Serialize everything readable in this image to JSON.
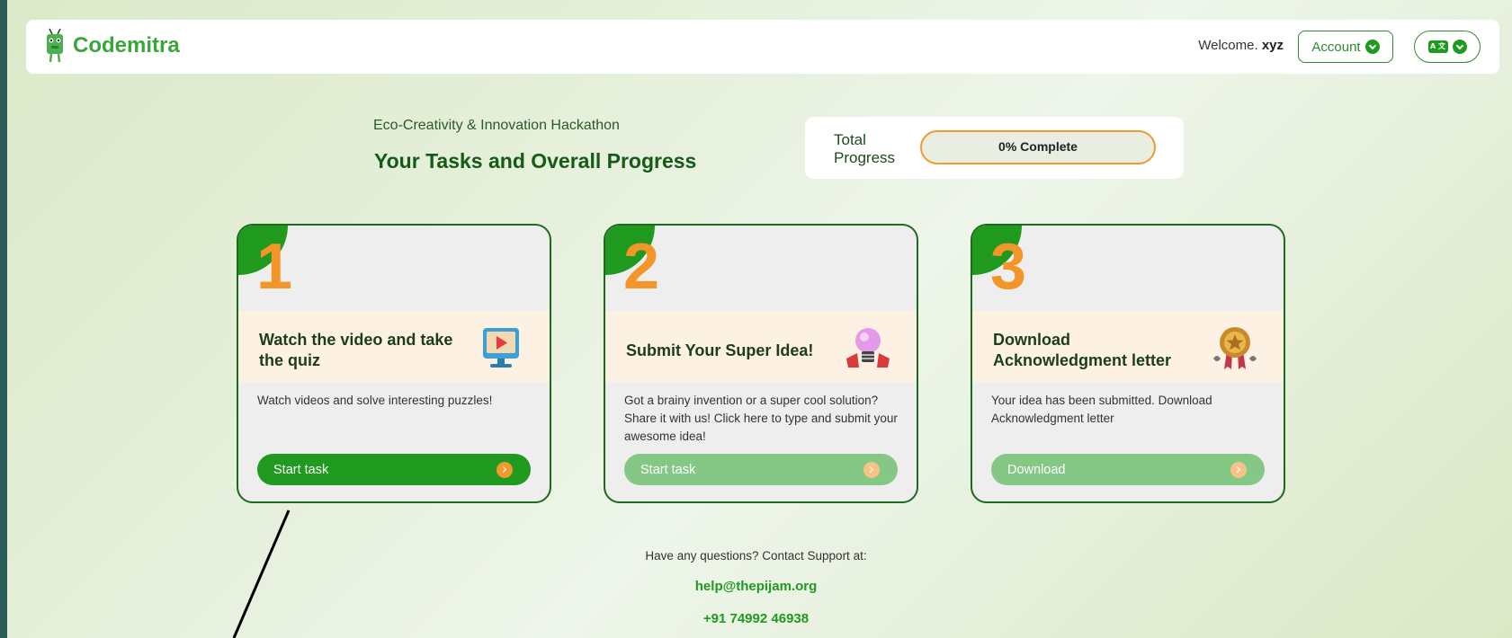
{
  "nav": {
    "brand": "Codemitra",
    "welcome_prefix": "Welcome.",
    "username": "xyz",
    "account_label": "Account",
    "lang_label": "A 文"
  },
  "header": {
    "event_name": "Eco-Creativity & Innovation Hackathon",
    "title": "Your Tasks and Overall Progress"
  },
  "progress": {
    "label_line1": "Total",
    "label_line2": "Progress",
    "percent": 0,
    "text": "0% Complete"
  },
  "tasks": [
    {
      "number": "1",
      "title": "Watch the video and take the quiz",
      "description": "Watch videos and solve interesting puzzles!",
      "action": "Start task",
      "icon": "video-monitor-icon"
    },
    {
      "number": "2",
      "title": "Submit Your Super Idea!",
      "description": "Got a brainy invention or a super cool solution? Share it with us! Click here to type and submit your awesome idea!",
      "action": "Start task",
      "icon": "lightbulb-icon"
    },
    {
      "number": "3",
      "title": "Download Acknowledgment letter",
      "description": "Your idea has been submitted. Download Acknowledgment letter",
      "action": "Download",
      "icon": "medal-icon"
    }
  ],
  "support": {
    "text": "Have any questions? Contact Support at:",
    "email": "help@thepijam.org",
    "phone": "+91 74992 46938"
  },
  "colors": {
    "brand_green": "#1f9a1f",
    "accent_orange": "#f29a2e",
    "dark_green": "#155a15"
  }
}
